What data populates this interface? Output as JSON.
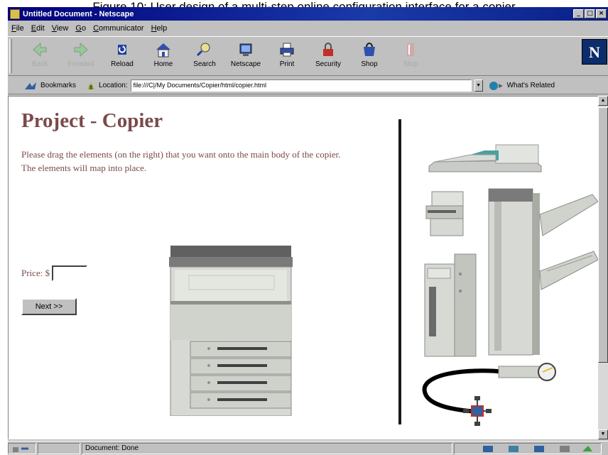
{
  "caption": "Figure 10: User design of a multi-step online configuration interface for a copier",
  "window": {
    "title": "Untitled Document - Netscape"
  },
  "menu": [
    "File",
    "Edit",
    "View",
    "Go",
    "Communicator",
    "Help"
  ],
  "toolbar": [
    {
      "label": "Back",
      "icon": "back-arrow-icon",
      "enabled": false
    },
    {
      "label": "Forward",
      "icon": "forward-arrow-icon",
      "enabled": false
    },
    {
      "label": "Reload",
      "icon": "reload-icon",
      "enabled": true
    },
    {
      "label": "Home",
      "icon": "home-icon",
      "enabled": true
    },
    {
      "label": "Search",
      "icon": "search-icon",
      "enabled": true
    },
    {
      "label": "Netscape",
      "icon": "netscape-icon",
      "enabled": true
    },
    {
      "label": "Print",
      "icon": "print-icon",
      "enabled": true
    },
    {
      "label": "Security",
      "icon": "lock-icon",
      "enabled": true
    },
    {
      "label": "Shop",
      "icon": "shop-icon",
      "enabled": true
    },
    {
      "label": "Stop",
      "icon": "stop-icon",
      "enabled": false
    }
  ],
  "location": {
    "bookmarks_label": "Bookmarks",
    "location_label": "Location:",
    "url": "file:///C|/My Documents/Copier/html/copier.html",
    "related_label": "What's Related"
  },
  "page": {
    "heading": "Project - Copier",
    "instructions": "Please drag the elements (on the right) that you want onto the main body of the copier. The elements will map into place.",
    "price_label": "Price: $",
    "price_value": "",
    "next_label": "Next >>"
  },
  "status": {
    "text": "Document: Done"
  },
  "colors": {
    "heading": "#7a4a4a",
    "title_bar": "#00007a",
    "chrome": "#c0c0c0"
  }
}
